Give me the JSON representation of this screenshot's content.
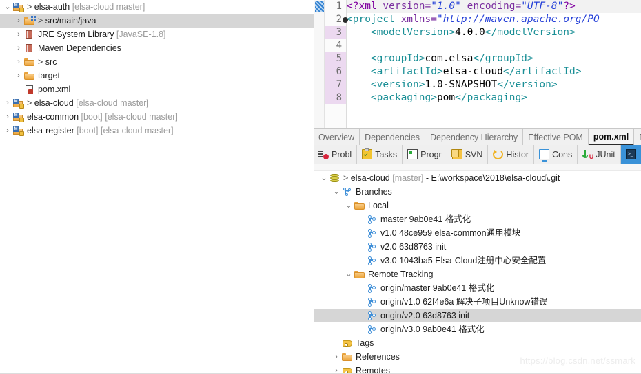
{
  "explorer": {
    "name": "package-explorer",
    "rows": [
      {
        "indent": 0,
        "arrow": "down",
        "icon": "maven-project-icon",
        "text": "elsa-auth",
        "gt": false,
        "suffix": " [elsa-cloud master]",
        "selected": false,
        "prefix": "> "
      },
      {
        "indent": 1,
        "arrow": "right",
        "icon": "package-folder-icon",
        "text": "src/main/java",
        "gt": true,
        "suffix": "",
        "selected": true,
        "prefix": "> "
      },
      {
        "indent": 1,
        "arrow": "right",
        "icon": "jar-library-icon",
        "text": "JRE System Library",
        "gt": false,
        "suffix": " [JavaSE-1.8]",
        "selected": false,
        "prefix": ""
      },
      {
        "indent": 1,
        "arrow": "right",
        "icon": "jar-library-icon",
        "text": "Maven Dependencies",
        "gt": false,
        "suffix": "",
        "selected": false,
        "prefix": ""
      },
      {
        "indent": 1,
        "arrow": "right",
        "icon": "folder-icon",
        "text": "src",
        "gt": true,
        "suffix": "",
        "selected": false,
        "prefix": "> "
      },
      {
        "indent": 1,
        "arrow": "right",
        "icon": "folder-icon",
        "text": "target",
        "gt": false,
        "suffix": "",
        "selected": false,
        "prefix": ""
      },
      {
        "indent": 1,
        "arrow": "none",
        "icon": "xml-file-icon",
        "text": "pom.xml",
        "gt": false,
        "suffix": "",
        "selected": false,
        "prefix": ""
      },
      {
        "indent": 0,
        "arrow": "right",
        "icon": "maven-project-icon",
        "text": "elsa-cloud",
        "gt": true,
        "suffix": " [elsa-cloud master]",
        "selected": false,
        "prefix": "> "
      },
      {
        "indent": 0,
        "arrow": "right",
        "icon": "maven-project-icon",
        "text": "elsa-common",
        "gt": false,
        "suffix": " [boot] [elsa-cloud master]",
        "selected": false,
        "prefix": ""
      },
      {
        "indent": 0,
        "arrow": "right",
        "icon": "maven-project-icon",
        "text": "elsa-register",
        "gt": false,
        "suffix": " [boot] [elsa-cloud master]",
        "selected": false,
        "prefix": ""
      }
    ]
  },
  "editor": {
    "name": "pom-xml-editor",
    "lines": [
      {
        "num": "1",
        "changed": false,
        "highlight": true,
        "fold": false,
        "tokens": [
          {
            "t": "<?xml ",
            "c": "tk"
          },
          {
            "t": "version=",
            "c": "at"
          },
          {
            "t": "\"1.0\"",
            "c": "av"
          },
          {
            "t": " ",
            "c": "txt"
          },
          {
            "t": "encoding=",
            "c": "at"
          },
          {
            "t": "\"UTF-8\"",
            "c": "av"
          },
          {
            "t": "?>",
            "c": "tk"
          }
        ]
      },
      {
        "num": "2",
        "changed": false,
        "highlight": false,
        "fold": true,
        "tokens": [
          {
            "t": "<project ",
            "c": "tg"
          },
          {
            "t": "xmlns=",
            "c": "at"
          },
          {
            "t": "\"http://maven.apache.org/PO",
            "c": "av"
          }
        ]
      },
      {
        "num": "3",
        "changed": true,
        "highlight": false,
        "fold": false,
        "tokens": [
          {
            "t": "    ",
            "c": "txt"
          },
          {
            "t": "<modelVersion>",
            "c": "tg"
          },
          {
            "t": "4.0.0",
            "c": "txt"
          },
          {
            "t": "</modelVersion>",
            "c": "tg"
          }
        ]
      },
      {
        "num": "4",
        "changed": false,
        "highlight": false,
        "fold": false,
        "tokens": [
          {
            "t": "",
            "c": "txt"
          }
        ]
      },
      {
        "num": "5",
        "changed": true,
        "highlight": false,
        "fold": false,
        "tokens": [
          {
            "t": "    ",
            "c": "txt"
          },
          {
            "t": "<groupId>",
            "c": "tg"
          },
          {
            "t": "com.elsa",
            "c": "txt"
          },
          {
            "t": "</groupId>",
            "c": "tg"
          }
        ]
      },
      {
        "num": "6",
        "changed": true,
        "highlight": false,
        "fold": false,
        "tokens": [
          {
            "t": "    ",
            "c": "txt"
          },
          {
            "t": "<artifactId>",
            "c": "tg"
          },
          {
            "t": "elsa-cloud",
            "c": "txt"
          },
          {
            "t": "</artifactId>",
            "c": "tg"
          }
        ]
      },
      {
        "num": "7",
        "changed": true,
        "highlight": false,
        "fold": false,
        "tokens": [
          {
            "t": "    ",
            "c": "txt"
          },
          {
            "t": "<version>",
            "c": "tg"
          },
          {
            "t": "1.0-SNAPSHOT",
            "c": "txt"
          },
          {
            "t": "</version>",
            "c": "tg"
          }
        ]
      },
      {
        "num": "8",
        "changed": true,
        "highlight": false,
        "fold": false,
        "tokens": [
          {
            "t": "    ",
            "c": "txt"
          },
          {
            "t": "<packaging>",
            "c": "tg"
          },
          {
            "t": "pom",
            "c": "txt"
          },
          {
            "t": "</packaging>",
            "c": "tg"
          }
        ]
      }
    ]
  },
  "form_tabs": {
    "name": "pom-editor-form-tabs",
    "items": [
      {
        "label": "Overview",
        "active": false
      },
      {
        "label": "Dependencies",
        "active": false
      },
      {
        "label": "Dependency Hierarchy",
        "active": false
      },
      {
        "label": "Effective POM",
        "active": false
      },
      {
        "label": "pom.xml",
        "active": true
      },
      {
        "label": "De",
        "active": false
      }
    ]
  },
  "view_tabs": {
    "name": "bottom-view-tabs",
    "items": [
      {
        "label": "Probl",
        "icon": "problems-icon",
        "selected": false
      },
      {
        "label": "Tasks",
        "icon": "tasks-icon",
        "selected": false
      },
      {
        "label": "Progr",
        "icon": "progress-icon",
        "selected": false
      },
      {
        "label": "SVN",
        "icon": "svn-icon",
        "selected": false
      },
      {
        "label": "Histor",
        "icon": "history-icon",
        "selected": false
      },
      {
        "label": "Cons",
        "icon": "console-icon",
        "selected": false
      },
      {
        "label": "JUnit",
        "icon": "junit-icon",
        "selected": false
      },
      {
        "label": "",
        "icon": "terminal-icon",
        "selected": true
      }
    ]
  },
  "git_view": {
    "name": "git-repositories-view",
    "rows": [
      {
        "indent": 0,
        "arrow": "down",
        "icon": "repository-icon",
        "prefix": "> ",
        "text": "elsa-cloud",
        "dim": " [master]",
        "tail": " - E:\\workspace\\2018\\elsa-cloud\\.git",
        "selected": false
      },
      {
        "indent": 1,
        "arrow": "down",
        "icon": "branches-icon",
        "prefix": "",
        "text": "Branches",
        "dim": "",
        "tail": "",
        "selected": false
      },
      {
        "indent": 2,
        "arrow": "down",
        "icon": "folder-icon",
        "prefix": "",
        "text": "Local",
        "dim": "",
        "tail": "",
        "selected": false
      },
      {
        "indent": 3,
        "arrow": "none",
        "icon": "branch-icon",
        "prefix": "",
        "text": "master 9ab0e41 格式化",
        "dim": "",
        "tail": "",
        "selected": false
      },
      {
        "indent": 3,
        "arrow": "none",
        "icon": "branch-icon",
        "prefix": "",
        "text": "v1.0 48ce959 elsa-common通用模块",
        "dim": "",
        "tail": "",
        "selected": false
      },
      {
        "indent": 3,
        "arrow": "none",
        "icon": "branch-icon",
        "prefix": "",
        "text": "v2.0 63d8763 init",
        "dim": "",
        "tail": "",
        "selected": false
      },
      {
        "indent": 3,
        "arrow": "none",
        "icon": "branch-icon",
        "prefix": "",
        "text": "v3.0 1043ba5 Elsa-Cloud注册中心安全配置",
        "dim": "",
        "tail": "",
        "selected": false
      },
      {
        "indent": 2,
        "arrow": "down",
        "icon": "folder-icon",
        "prefix": "",
        "text": "Remote Tracking",
        "dim": "",
        "tail": "",
        "selected": false
      },
      {
        "indent": 3,
        "arrow": "none",
        "icon": "branch-icon",
        "prefix": "",
        "text": "origin/master 9ab0e41 格式化",
        "dim": "",
        "tail": "",
        "selected": false
      },
      {
        "indent": 3,
        "arrow": "none",
        "icon": "branch-icon",
        "prefix": "",
        "text": "origin/v1.0 62f4e6a 解决子项目Unknow错误",
        "dim": "",
        "tail": "",
        "selected": false
      },
      {
        "indent": 3,
        "arrow": "none",
        "icon": "branch-icon",
        "prefix": "",
        "text": "origin/v2.0 63d8763 init",
        "dim": "",
        "tail": "",
        "selected": true
      },
      {
        "indent": 3,
        "arrow": "none",
        "icon": "branch-icon",
        "prefix": "",
        "text": "origin/v3.0 9ab0e41 格式化",
        "dim": "",
        "tail": "",
        "selected": false
      },
      {
        "indent": 1,
        "arrow": "none",
        "icon": "tag-icon",
        "prefix": "",
        "text": "Tags",
        "dim": "",
        "tail": "",
        "selected": false
      },
      {
        "indent": 1,
        "arrow": "right",
        "icon": "folder-icon",
        "prefix": "",
        "text": "References",
        "dim": "",
        "tail": "",
        "selected": false
      },
      {
        "indent": 1,
        "arrow": "right",
        "icon": "tag-icon",
        "prefix": "",
        "text": "Remotes",
        "dim": "",
        "tail": "",
        "selected": false
      }
    ]
  },
  "watermark": {
    "text": "https://blog.csdn.net/ssmark"
  },
  "colors": {
    "selection_gray": "#d6d6d6",
    "tab_selected_blue": "#3a92d8",
    "xml_tag": "#1a8f96",
    "xml_attr_value": "#2641d8",
    "xml_pi": "#8000a0",
    "gutter_changed": "#ecd9f0",
    "folder_orange": "#f0b357",
    "branch_blue": "#3f8fd8"
  }
}
